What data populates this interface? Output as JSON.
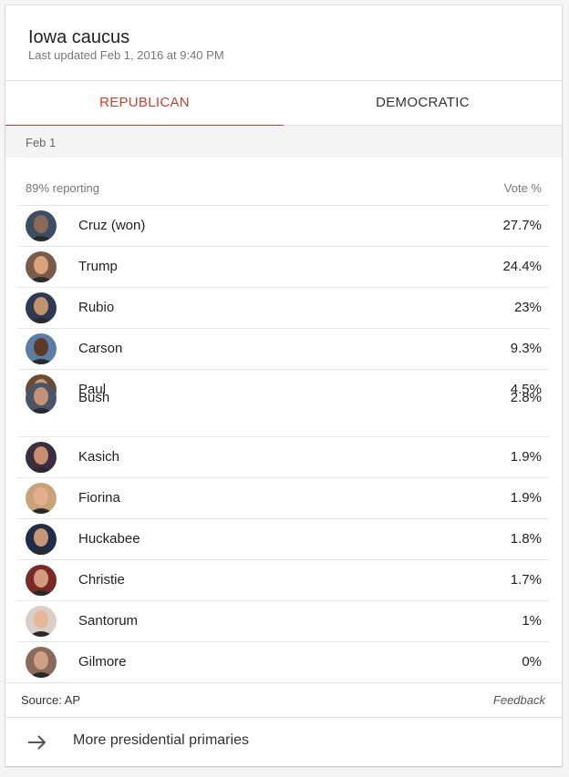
{
  "header": {
    "title": "Iowa caucus",
    "subtitle": "Last updated Feb 1, 2016 at 9:40 PM"
  },
  "tabs": [
    {
      "label": "REPUBLICAN",
      "active": true
    },
    {
      "label": "DEMOCRATIC",
      "active": false
    }
  ],
  "date_label": "Feb 1",
  "table": {
    "reporting": "89% reporting",
    "vote_header": "Vote %",
    "candidates": [
      {
        "name": "Cruz (won)",
        "pct": "27.7%",
        "face": "#8a6a56",
        "bg": "#3c4d66"
      },
      {
        "name": "Trump",
        "pct": "24.4%",
        "face": "#d9a27b",
        "bg": "#7a5a4a"
      },
      {
        "name": "Rubio",
        "pct": "23%",
        "face": "#c4916d",
        "bg": "#2e3a52"
      },
      {
        "name": "Carson",
        "pct": "9.3%",
        "face": "#5b3a28",
        "bg": "#5a7ea5"
      },
      {
        "name": "Paul",
        "pct": "4.5%",
        "face": "#c89a7a",
        "bg": "#6b4a36"
      },
      {
        "name": "Bush",
        "pct": "2.8%",
        "face": "#c49276",
        "bg": "#4a5566"
      },
      {
        "name": "Kasich",
        "pct": "1.9%",
        "face": "#c98d70",
        "bg": "#3a2e40"
      },
      {
        "name": "Fiorina",
        "pct": "1.9%",
        "face": "#e2b08e",
        "bg": "#c9a27a"
      },
      {
        "name": "Huckabee",
        "pct": "1.8%",
        "face": "#c89576",
        "bg": "#1f2d4a"
      },
      {
        "name": "Christie",
        "pct": "1.7%",
        "face": "#d49a7e",
        "bg": "#7a2a26"
      },
      {
        "name": "Santorum",
        "pct": "1%",
        "face": "#e3b79a",
        "bg": "#d9cfc8"
      },
      {
        "name": "Gilmore",
        "pct": "0%",
        "face": "#cfa088",
        "bg": "#8a6a5a"
      }
    ]
  },
  "footer": {
    "source": "Source: AP",
    "feedback": "Feedback"
  },
  "more": {
    "label": "More presidential primaries",
    "icon": "arrow-right-icon"
  },
  "colors": {
    "accent": "#c5422e"
  }
}
